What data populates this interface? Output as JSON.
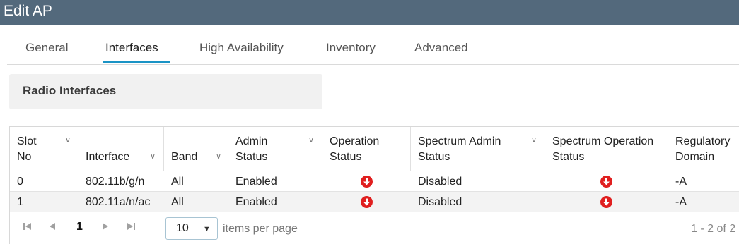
{
  "window": {
    "title": "Edit AP"
  },
  "tabs": [
    {
      "label": "General",
      "active": false
    },
    {
      "label": "Interfaces",
      "active": true
    },
    {
      "label": "High Availability",
      "active": false
    },
    {
      "label": "Inventory",
      "active": false
    },
    {
      "label": "Advanced",
      "active": false
    }
  ],
  "section": {
    "title": "Radio Interfaces"
  },
  "table": {
    "columns": [
      {
        "label": "Slot\nNo",
        "sortable": true
      },
      {
        "label": "Interface",
        "sortable": true
      },
      {
        "label": "Band",
        "sortable": true
      },
      {
        "label": "Admin\nStatus",
        "sortable": true
      },
      {
        "label": "Operation\nStatus",
        "sortable": false
      },
      {
        "label": "Spectrum Admin\nStatus",
        "sortable": true
      },
      {
        "label": "Spectrum Operation\nStatus",
        "sortable": false
      },
      {
        "label": "Regulatory\nDomain",
        "sortable": false
      }
    ],
    "rows": [
      {
        "slot": "0",
        "interface": "802.11b/g/n",
        "band": "All",
        "admin_status": "Enabled",
        "operation_status": "down-icon",
        "spectrum_admin_status": "Disabled",
        "spectrum_operation_status": "down-icon",
        "regulatory_domain": "-A"
      },
      {
        "slot": "1",
        "interface": "802.11a/n/ac",
        "band": "All",
        "admin_status": "Enabled",
        "operation_status": "down-icon",
        "spectrum_admin_status": "Disabled",
        "spectrum_operation_status": "down-icon",
        "regulatory_domain": "-A"
      }
    ],
    "status_color": "#e01f1f"
  },
  "pagination": {
    "current_page": "1",
    "per_page": "10",
    "per_page_label": "items per page",
    "range_text": "1 - 2 of 2"
  }
}
